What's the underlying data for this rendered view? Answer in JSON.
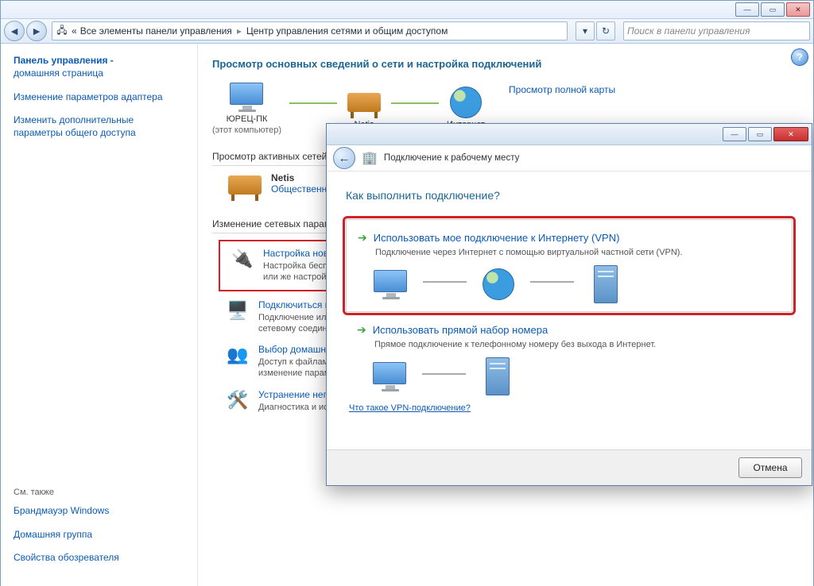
{
  "outer_window": {
    "breadcrumb": {
      "chevrons": "«",
      "level1": "Все элементы панели управления",
      "level2": "Центр управления сетями и общим доступом"
    },
    "search_placeholder": "Поиск в панели управления"
  },
  "left_pane": {
    "heading1": "Панель управления -",
    "heading2": "домашняя страница",
    "link_adapter": "Изменение параметров адаптера",
    "link_sharing": "Изменить дополнительные параметры общего доступа",
    "see_also": "См. также",
    "see_also_links": {
      "firewall": "Брандмауэр Windows",
      "homegroup": "Домашняя группа",
      "browser": "Свойства обозревателя"
    }
  },
  "right_pane": {
    "title": "Просмотр основных сведений о сети и настройка подключений",
    "full_map_link": "Просмотр полной карты",
    "nodes": {
      "pc_name": "ЮРЕЦ-ПК",
      "pc_sub": "(этот компьютер)",
      "router": "Netis",
      "internet": "Интернет"
    },
    "active_networks_label": "Просмотр активных сетей",
    "active_net": {
      "name": "Netis",
      "type": "Общественная сеть"
    },
    "change_settings_label": "Изменение сетевых параметров",
    "tasks": {
      "new_conn_title": "Настройка нового под",
      "new_conn_desc1": "Настройка беспроводно",
      "new_conn_desc2": "или же настройка мар",
      "connect_title": "Подключиться к сети",
      "connect_desc1": "Подключение или пов",
      "connect_desc2": "сетевому соединению",
      "homegroup_title": "Выбор домашней груп",
      "homegroup_desc1": "Доступ к файлам и пр",
      "homegroup_desc2": "изменение параметро",
      "troubleshoot_title": "Устранение неполадо",
      "troubleshoot_desc": "Диагностика и исправ."
    }
  },
  "dialog": {
    "header_text": "Подключение к рабочему месту",
    "question": "Как выполнить подключение?",
    "opt_vpn_title": "Использовать мое подключение к Интернету (VPN)",
    "opt_vpn_desc": "Подключение через Интернет с помощью виртуальной частной сети (VPN).",
    "opt_dial_title": "Использовать прямой набор номера",
    "opt_dial_desc": "Прямое подключение к телефонному номеру без выхода в Интернет.",
    "link_what_is_vpn": "Что такое VPN-подключение?",
    "cancel": "Отмена"
  }
}
